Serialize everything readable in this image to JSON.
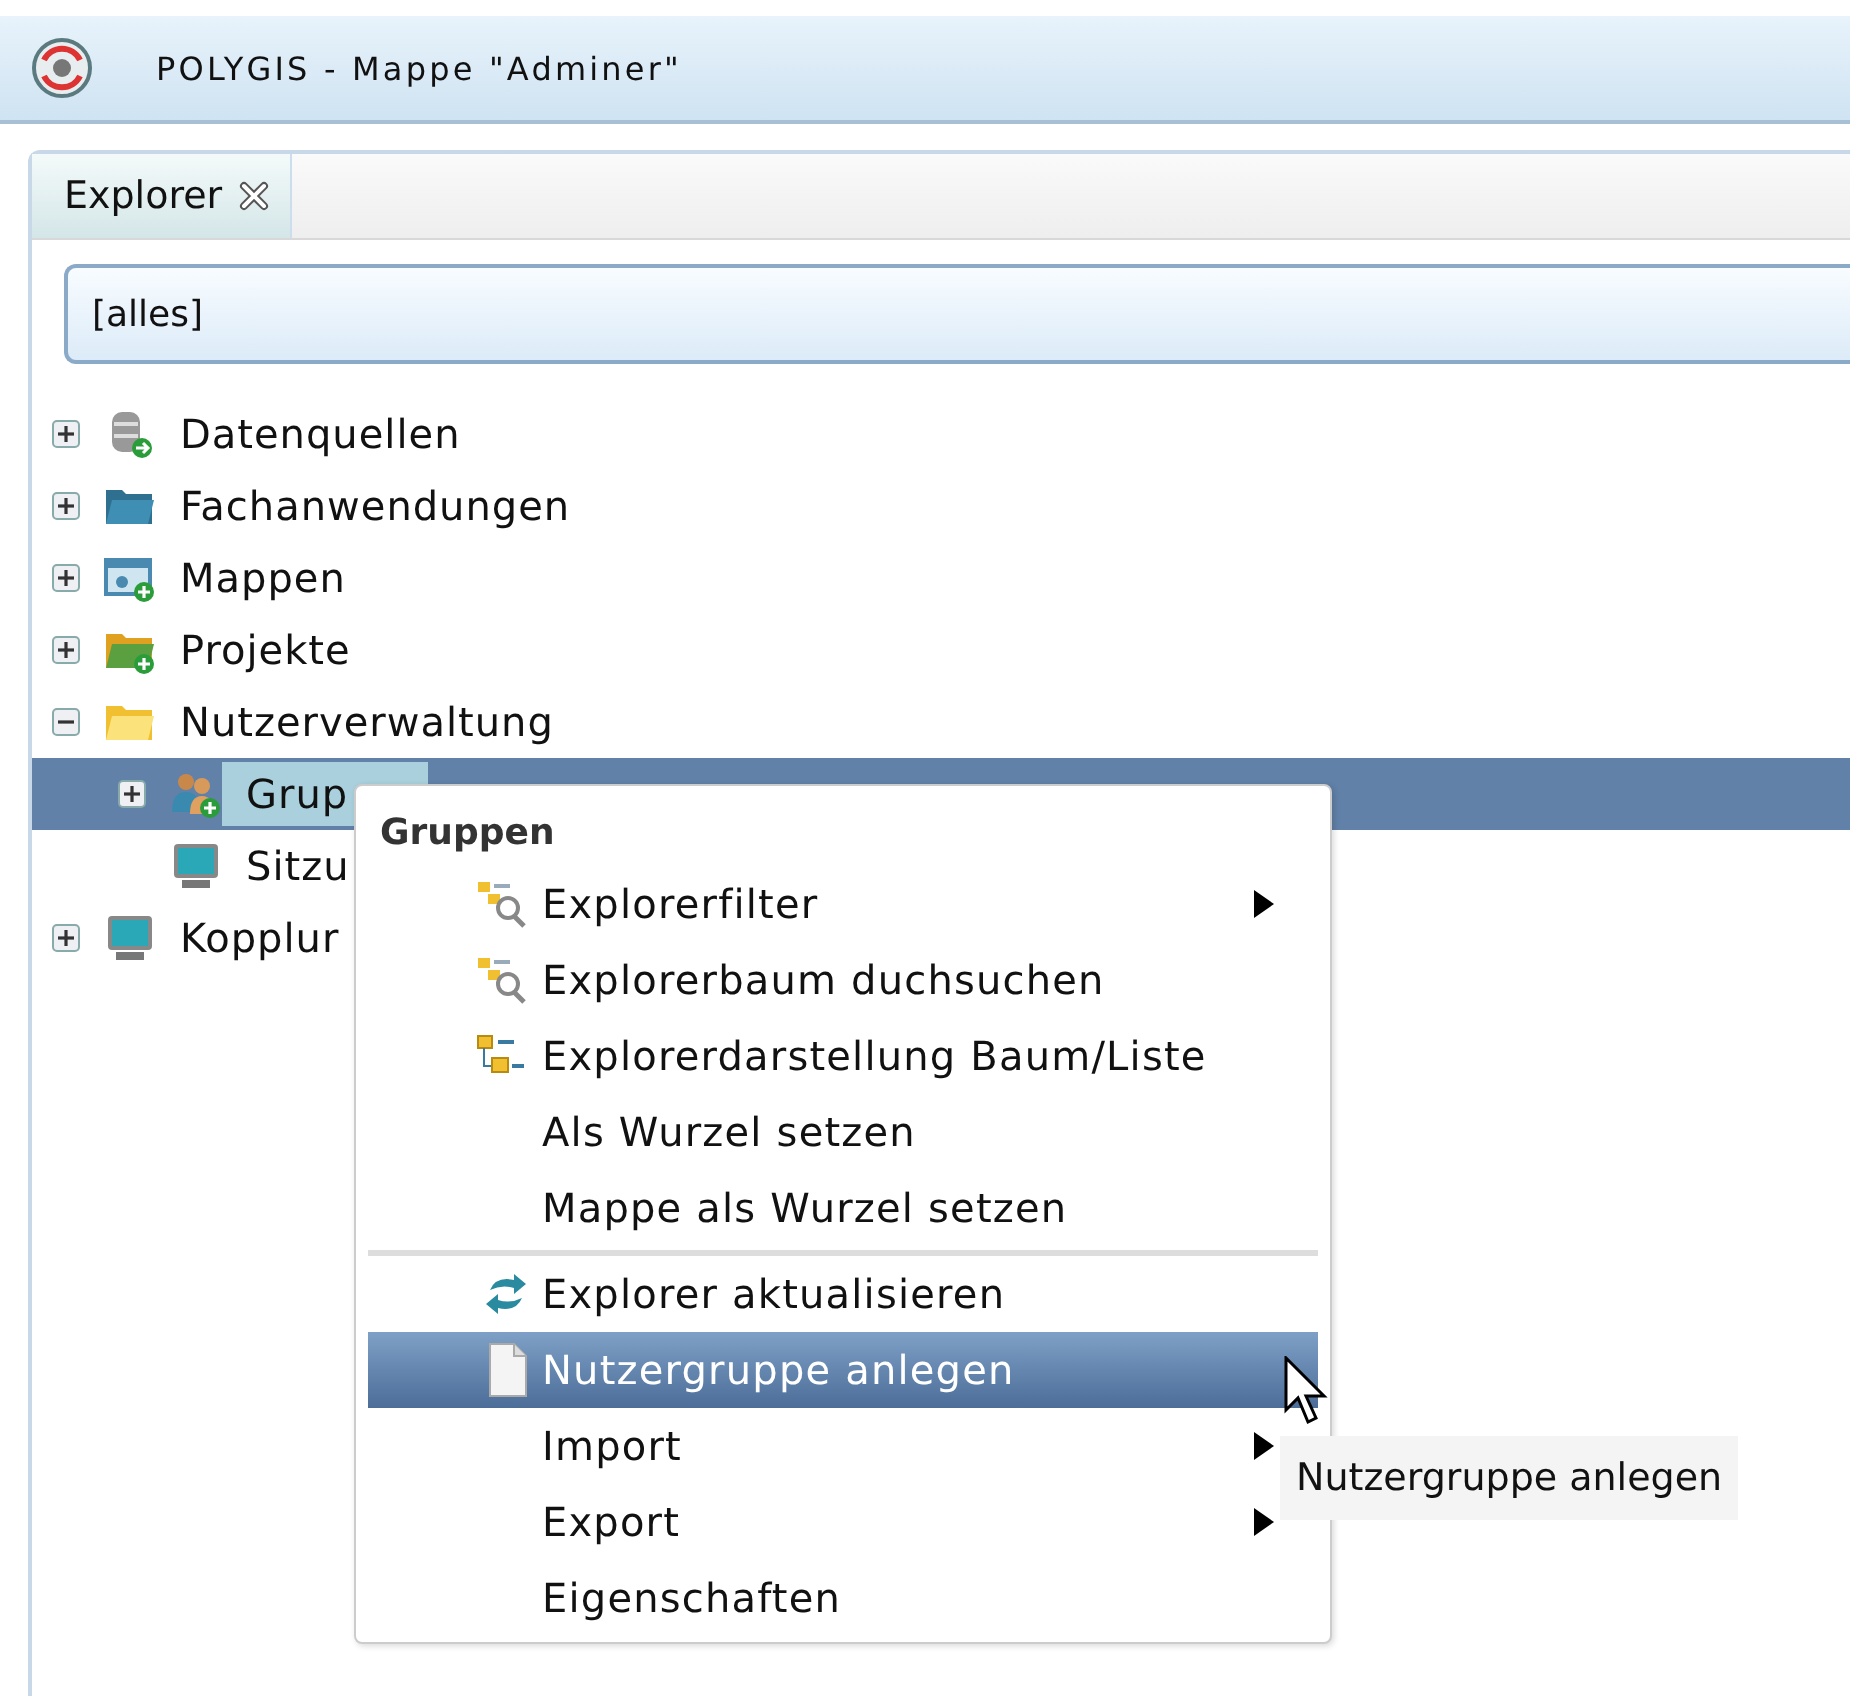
{
  "window": {
    "title": "POLYGIS - Mappe \"Adminer\""
  },
  "tabs": [
    {
      "label": "Explorer",
      "selected": true
    }
  ],
  "filter": {
    "value": "[alles]"
  },
  "tree": [
    {
      "label": "Datenquellen",
      "kind": "database",
      "expandable": true,
      "expanded": false,
      "selected": false
    },
    {
      "label": "Fachanwendungen",
      "kind": "folder-blue",
      "expandable": true,
      "expanded": false,
      "selected": false
    },
    {
      "label": "Mappen",
      "kind": "map",
      "expandable": true,
      "expanded": false,
      "selected": false
    },
    {
      "label": "Projekte",
      "kind": "folder-green",
      "expandable": true,
      "expanded": false,
      "selected": false
    },
    {
      "label": "Nutzerverwaltung",
      "kind": "folder-yellow",
      "expandable": true,
      "expanded": true,
      "selected": false,
      "children": [
        {
          "label": "Grup",
          "kind": "users",
          "expandable": true,
          "expanded": false,
          "selected": true
        },
        {
          "label": "Sitzu",
          "kind": "monitor",
          "expandable": false,
          "selected": false
        }
      ]
    },
    {
      "label": "Kopplur",
      "kind": "monitor",
      "expandable": true,
      "expanded": false,
      "selected": false
    }
  ],
  "context_menu": {
    "header": "Gruppen",
    "items": [
      {
        "label": "Explorerfilter",
        "kind": "filter",
        "submenu": true,
        "selected": false,
        "separator_before": false
      },
      {
        "label": "Explorerbaum duchsuchen",
        "kind": "filter",
        "submenu": false,
        "selected": false,
        "separator_before": false
      },
      {
        "label": "Explorerdarstellung Baum/Liste",
        "kind": "tree",
        "submenu": false,
        "selected": false,
        "separator_before": false
      },
      {
        "label": "Als Wurzel setzen",
        "kind": "plain",
        "submenu": false,
        "selected": false,
        "separator_before": false
      },
      {
        "label": "Mappe als Wurzel setzen",
        "kind": "plain",
        "submenu": false,
        "selected": false,
        "separator_before": false
      },
      {
        "label": "Explorer aktualisieren",
        "kind": "refresh",
        "submenu": false,
        "selected": false,
        "separator_before": true
      },
      {
        "label": "Nutzergruppe anlegen",
        "kind": "page",
        "submenu": false,
        "selected": true,
        "separator_before": false
      },
      {
        "label": "Import",
        "kind": "plain",
        "submenu": true,
        "selected": false,
        "separator_before": false
      },
      {
        "label": "Export",
        "kind": "plain",
        "submenu": true,
        "selected": false,
        "separator_before": false
      },
      {
        "label": "Eigenschaften",
        "kind": "plain",
        "submenu": false,
        "selected": false,
        "separator_before": false
      }
    ]
  },
  "tooltip": {
    "text": "Nutzergruppe anlegen"
  }
}
